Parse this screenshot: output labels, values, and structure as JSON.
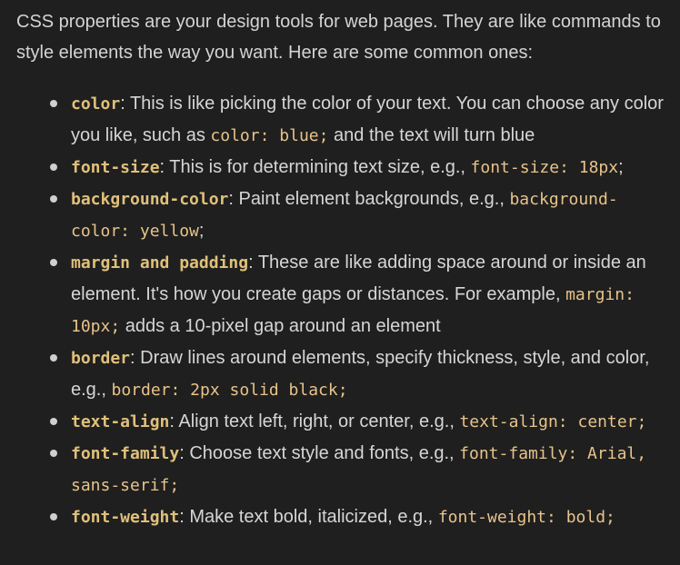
{
  "intro": "CSS properties are your design tools for web pages. They are like commands to style elements the way you want. Here are some common ones:",
  "items": [
    {
      "term": "color",
      "desc_before": ": This is like picking the color of your text. You can choose any color you like, such as ",
      "code": "color: blue;",
      "desc_after": " and the text will turn blue"
    },
    {
      "term": "font-size",
      "desc_before": ": This is for determining text size, e.g., ",
      "code": "font-size: 18px",
      "desc_after": ";"
    },
    {
      "term": "background-color",
      "desc_before": ": Paint element backgrounds, e.g., ",
      "code": "background-color: yellow",
      "desc_after": ";"
    },
    {
      "term": "margin and padding",
      "desc_before": ": These are like adding space around or inside an element. It's how you create gaps or distances. For example, ",
      "code": "margin: 10px;",
      "desc_after": " adds a 10-pixel gap around an element"
    },
    {
      "term": "border",
      "desc_before": ": Draw lines around elements, specify thickness, style, and color, e.g., ",
      "code": "border: 2px solid black;",
      "desc_after": ""
    },
    {
      "term": "text-align",
      "desc_before": ": Align text left, right, or center, e.g., ",
      "code": "text-align: center;",
      "desc_after": ""
    },
    {
      "term": "font-family",
      "desc_before": ": Choose text style and fonts, e.g., ",
      "code": "font-family: Arial, sans-serif;",
      "desc_after": ""
    },
    {
      "term": "font-weight",
      "desc_before": ": Make text bold, italicized, e.g., ",
      "code": "font-weight: bold;",
      "desc_after": ""
    }
  ],
  "colors": {
    "background": "#1f1f1f",
    "text": "#d4d4d4",
    "code": "#e8c38a",
    "term": "#e0c07a"
  }
}
